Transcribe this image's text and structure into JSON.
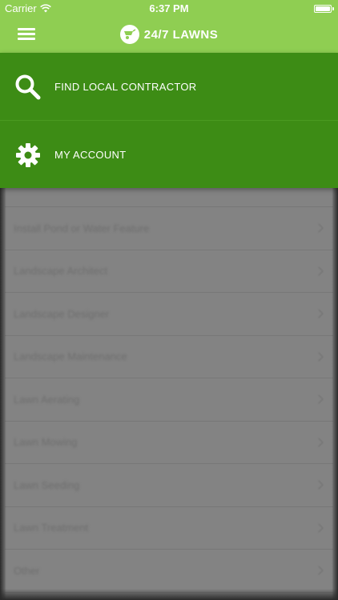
{
  "status_bar": {
    "carrier": "Carrier",
    "time": "6:37 PM"
  },
  "nav": {
    "logo_text": "24/7 LAWNS"
  },
  "drawer": {
    "items": [
      {
        "label": "FIND LOCAL CONTRACTOR",
        "icon": "search-icon"
      },
      {
        "label": "MY ACCOUNT",
        "icon": "gear-icon"
      }
    ]
  },
  "list": {
    "items": [
      {
        "label": "Install Pond or Water Feature"
      },
      {
        "label": "Landscape Architect"
      },
      {
        "label": "Landscape Designer"
      },
      {
        "label": "Landscape Maintenance"
      },
      {
        "label": "Lawn Aerating"
      },
      {
        "label": "Lawn Mowing"
      },
      {
        "label": "Lawn Seeding"
      },
      {
        "label": "Lawn Treatment"
      },
      {
        "label": "Other"
      }
    ]
  },
  "colors": {
    "header_green": "#8fce52",
    "drawer_green": "#3d8c15",
    "dim_overlay": "#7c7c7c"
  }
}
